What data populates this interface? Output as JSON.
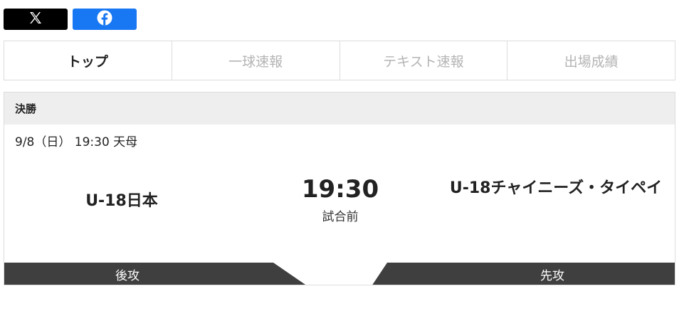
{
  "share": {
    "x_icon": "x-logo-icon",
    "facebook_icon": "facebook-logo-icon"
  },
  "tabs": [
    {
      "label": "トップ",
      "active": true
    },
    {
      "label": "一球速報",
      "active": false
    },
    {
      "label": "テキスト速報",
      "active": false
    },
    {
      "label": "出場成績",
      "active": false
    }
  ],
  "game": {
    "round": "決勝",
    "meta": "9/8（日） 19:30 天母",
    "home_team": "U-18日本",
    "away_team": "U-18チャイニーズ・タイペイ",
    "start_time": "19:30",
    "status": "試合前",
    "home_order": "後攻",
    "away_order": "先攻"
  },
  "colors": {
    "bar": "#3f3f3f",
    "facebook": "#1877f2",
    "x": "#000000"
  }
}
